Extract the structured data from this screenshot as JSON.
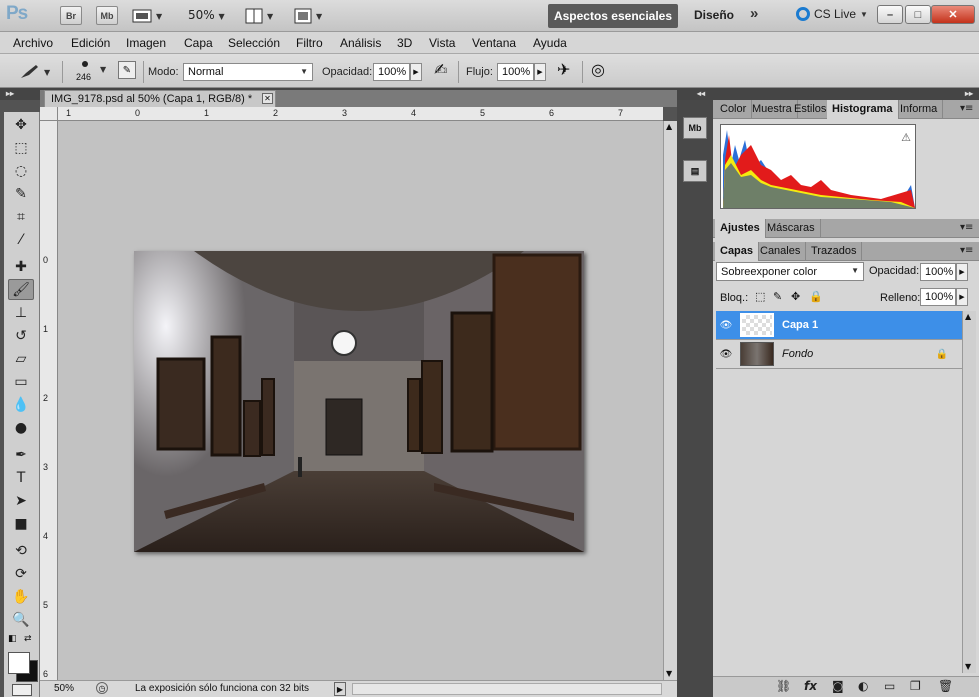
{
  "app": {
    "logo": "Ps",
    "bridge_label": "Br",
    "minibridge_label": "Mb",
    "zoom": "50%"
  },
  "workspace": {
    "active": "Aspectos esenciales",
    "design": "Diseño",
    "more": "»",
    "cslive": "CS Live"
  },
  "window": {
    "minimize": "–",
    "restore": "□",
    "close": "✕"
  },
  "menu": [
    "Archivo",
    "Edición",
    "Imagen",
    "Capa",
    "Selección",
    "Filtro",
    "Análisis",
    "3D",
    "Vista",
    "Ventana",
    "Ayuda"
  ],
  "options": {
    "brush_size": "246",
    "mode_label": "Modo:",
    "mode_value": "Normal",
    "opacity_label": "Opacidad:",
    "opacity_value": "100%",
    "flow_label": "Flujo:",
    "flow_value": "100%"
  },
  "document": {
    "tab_title": "IMG_9178.psd al 50% (Capa 1, RGB/8) *",
    "status_zoom": "50%",
    "status_text": "La exposición sólo funciona con 32 bits"
  },
  "rulers": {
    "top": [
      "1",
      "0",
      "1",
      "2",
      "3",
      "4",
      "5",
      "6",
      "7"
    ],
    "left": [
      "0",
      "1",
      "2",
      "3",
      "4",
      "5",
      "6"
    ]
  },
  "panels": {
    "top_tabs": [
      "Color",
      "Muestra",
      "Estilos",
      "Histograma",
      "Informa"
    ],
    "top_active": "Histograma",
    "mid_tabs": [
      "Ajustes",
      "Máscaras"
    ],
    "layer_tabs": [
      "Capas",
      "Canales",
      "Trazados"
    ],
    "blend_mode": "Sobreexponer color",
    "opacity_label": "Opacidad:",
    "opacity_value": "100%",
    "lock_label": "Bloq.:",
    "fill_label": "Relleno:",
    "fill_value": "100%"
  },
  "layers": [
    {
      "name": "Capa 1",
      "selected": true
    },
    {
      "name": "Fondo",
      "selected": false
    }
  ],
  "colors": {
    "accent": "#3d8fe8",
    "dark": "#535353"
  }
}
